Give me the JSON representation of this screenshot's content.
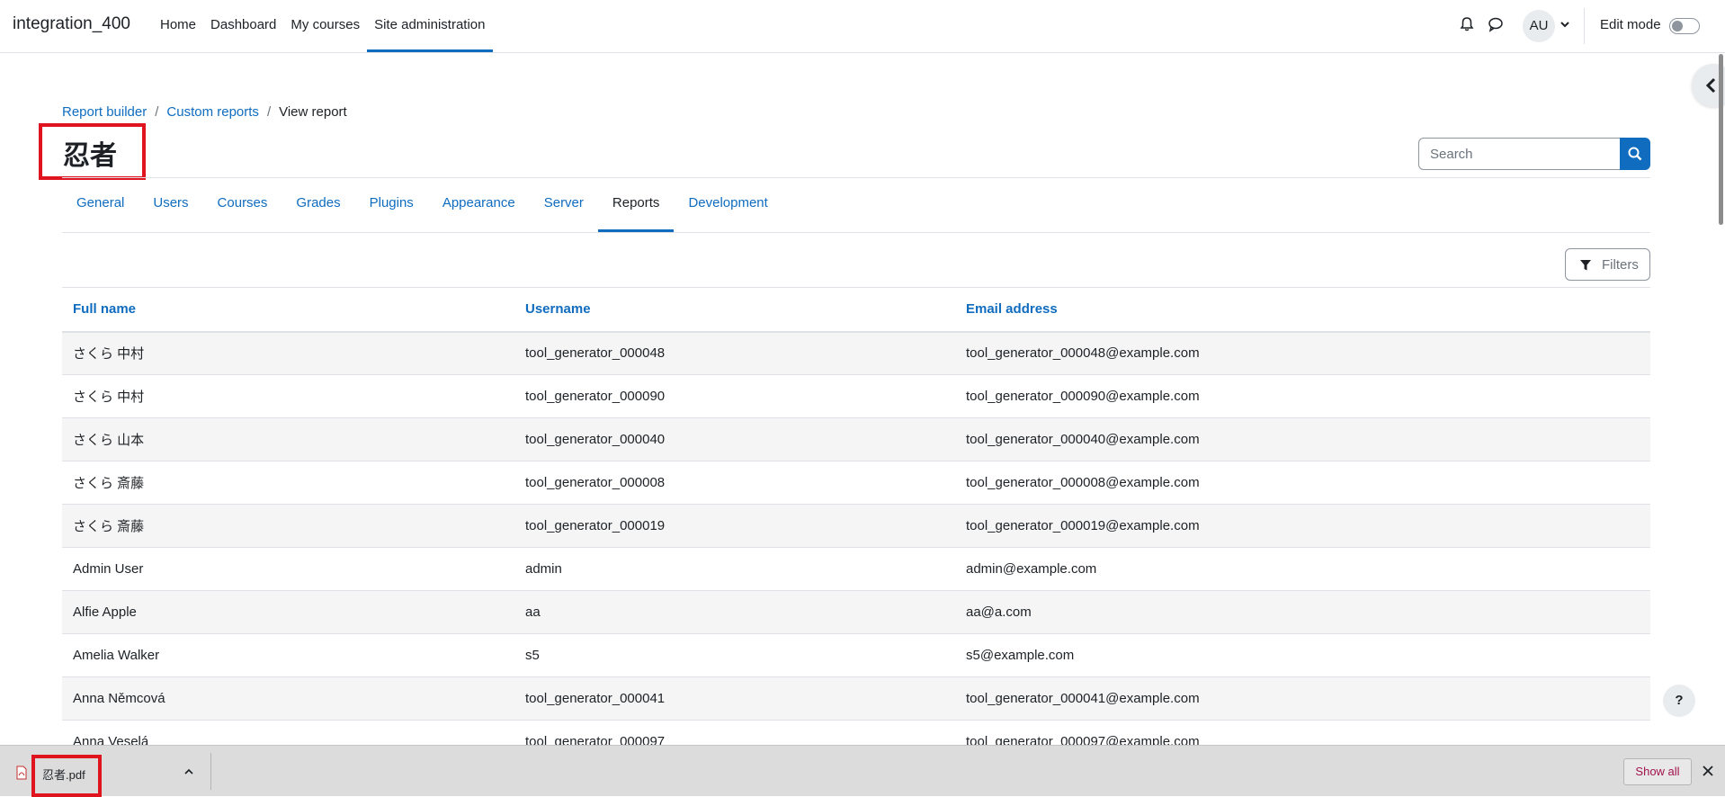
{
  "navbar": {
    "brand": "integration_400",
    "links": [
      "Home",
      "Dashboard",
      "My courses",
      "Site administration"
    ],
    "avatar_initials": "AU",
    "edit_mode_label": "Edit mode"
  },
  "breadcrumb": {
    "items": [
      "Report builder",
      "Custom reports",
      "View report"
    ]
  },
  "page": {
    "title": "忍者",
    "search_placeholder": "Search"
  },
  "tabs": [
    "General",
    "Users",
    "Courses",
    "Grades",
    "Plugins",
    "Appearance",
    "Server",
    "Reports",
    "Development"
  ],
  "filters_label": "Filters",
  "table": {
    "headers": [
      "Full name",
      "Username",
      "Email address"
    ],
    "rows": [
      [
        "さくら 中村",
        "tool_generator_000048",
        "tool_generator_000048@example.com"
      ],
      [
        "さくら 中村",
        "tool_generator_000090",
        "tool_generator_000090@example.com"
      ],
      [
        "さくら 山本",
        "tool_generator_000040",
        "tool_generator_000040@example.com"
      ],
      [
        "さくら 斎藤",
        "tool_generator_000008",
        "tool_generator_000008@example.com"
      ],
      [
        "さくら 斎藤",
        "tool_generator_000019",
        "tool_generator_000019@example.com"
      ],
      [
        "Admin User",
        "admin",
        "admin@example.com"
      ],
      [
        "Alfie Apple",
        "aa",
        "aa@a.com"
      ],
      [
        "Amelia Walker",
        "s5",
        "s5@example.com"
      ],
      [
        "Anna Němcová",
        "tool_generator_000041",
        "tool_generator_000041@example.com"
      ],
      [
        "Anna Veselá",
        "tool_generator_000097",
        "tool_generator_000097@example.com"
      ]
    ]
  },
  "help_label": "?",
  "download_bar": {
    "file_name": "忍者.pdf",
    "show_all_label": "Show all"
  },
  "colors": {
    "accent": "#0f6cbf",
    "highlight": "#e0141e",
    "stripe": "#f5f5f5"
  },
  "icons": [
    "bell-icon",
    "chat-icon",
    "chevron-down-icon",
    "chevron-left-icon",
    "search-icon",
    "filter-icon",
    "pdf-file-icon",
    "chevron-up-icon",
    "close-icon"
  ]
}
